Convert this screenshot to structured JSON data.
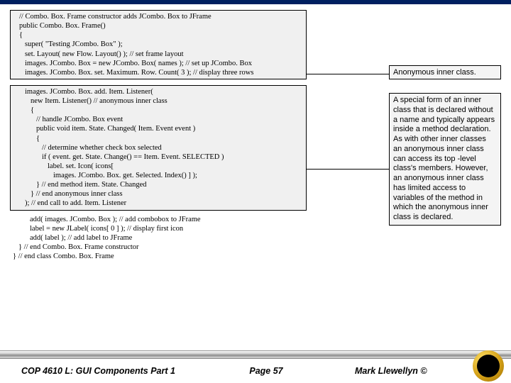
{
  "code1": {
    "l1": "// Combo. Box. Frame constructor adds JCombo. Box to JFrame",
    "l2": "public Combo. Box. Frame()",
    "l3": "{",
    "l4": "super( \"Testing JCombo. Box\" );",
    "l5": "set. Layout( new Flow. Layout() ); // set frame layout",
    "l6": "images. JCombo. Box = new JCombo. Box( names ); // set up JCombo. Box",
    "l7": "images. JCombo. Box. set. Maximum. Row. Count( 3 ); // display three rows"
  },
  "code2": {
    "l1": "images. JCombo. Box. add. Item. Listener(",
    "l2": "new Item. Listener() // anonymous inner class",
    "l3": "{",
    "l4": "// handle JCombo. Box event",
    "l5": "public void item. State. Changed( Item. Event event )",
    "l6": "{",
    "l7": "// determine whether check box selected",
    "l8": "if ( event. get. State. Change() == Item. Event. SELECTED )",
    "l9": "label. set. Icon( icons[",
    "l10": "images. JCombo. Box. get. Selected. Index() ] );",
    "l11": "} // end method item. State. Changed",
    "l12": "} // end anonymous inner class",
    "l13": "); // end call to add. Item. Listener"
  },
  "code3": {
    "l1": "add( images. JCombo. Box ); // add combobox to JFrame",
    "l2": "label = new JLabel( icons[ 0 ] ); // display first icon",
    "l3": "add( label ); // add label to JFrame",
    "l4": "} // end Combo. Box. Frame constructor",
    "l5": "} // end class Combo. Box. Frame"
  },
  "annot1": "Anonymous inner class.",
  "annot2": "A special form of an inner class that is declared without a name and typically appears inside a method declaration.  As with other inner classes an anonymous inner class can access its top -level class's members.  However, an anonymous inner class has limited access to variables of the method in which the anonymous inner class is declared.",
  "footer": {
    "left": "COP 4610 L: GUI Components Part 1",
    "mid": "Page 57",
    "right": "Mark Llewellyn ©"
  }
}
